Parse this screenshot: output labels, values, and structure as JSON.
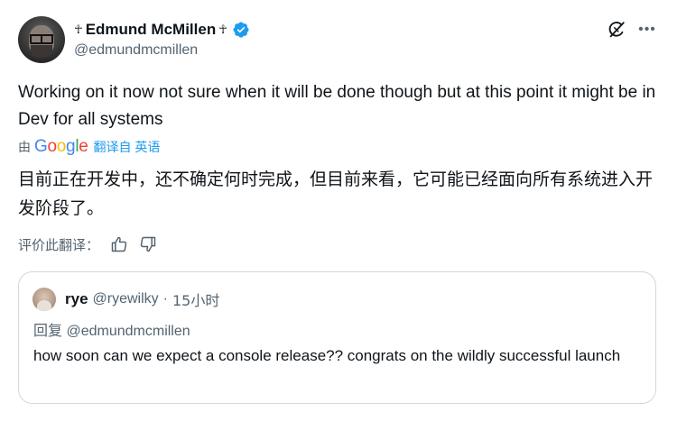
{
  "author": {
    "name_prefix_icon": "ankh-icon",
    "display_name": "Edmund McMillen",
    "name_suffix_icon": "ankh-icon",
    "verified": true,
    "verified_color": "#1d9bf0",
    "handle": "@edmundmcmillen"
  },
  "tweet": {
    "text": "Working on it now not sure when it will be done though but at this point it might be in Dev for all systems",
    "translation": {
      "by_label": "由",
      "provider_letters": [
        "G",
        "o",
        "o",
        "g",
        "l",
        "e"
      ],
      "from_label": "翻译自 英语",
      "text": "目前正在开发中，还不确定何时完成，但目前来看，它可能已经面向所有系统进入开发阶段了。",
      "rate_label": "评价此翻译："
    }
  },
  "quoted_tweet": {
    "display_name": "rye",
    "handle": "@ryewilky",
    "separator": "·",
    "time": "15小时",
    "reply_prefix": "回复",
    "reply_to": "@edmundmcmillen",
    "text": "how soon can we expect a console release?? congrats on the wildly successful launch"
  },
  "colors": {
    "text_primary": "#0f1419",
    "text_secondary": "#536471",
    "accent": "#1d9bf0",
    "border": "#cfd9de"
  }
}
